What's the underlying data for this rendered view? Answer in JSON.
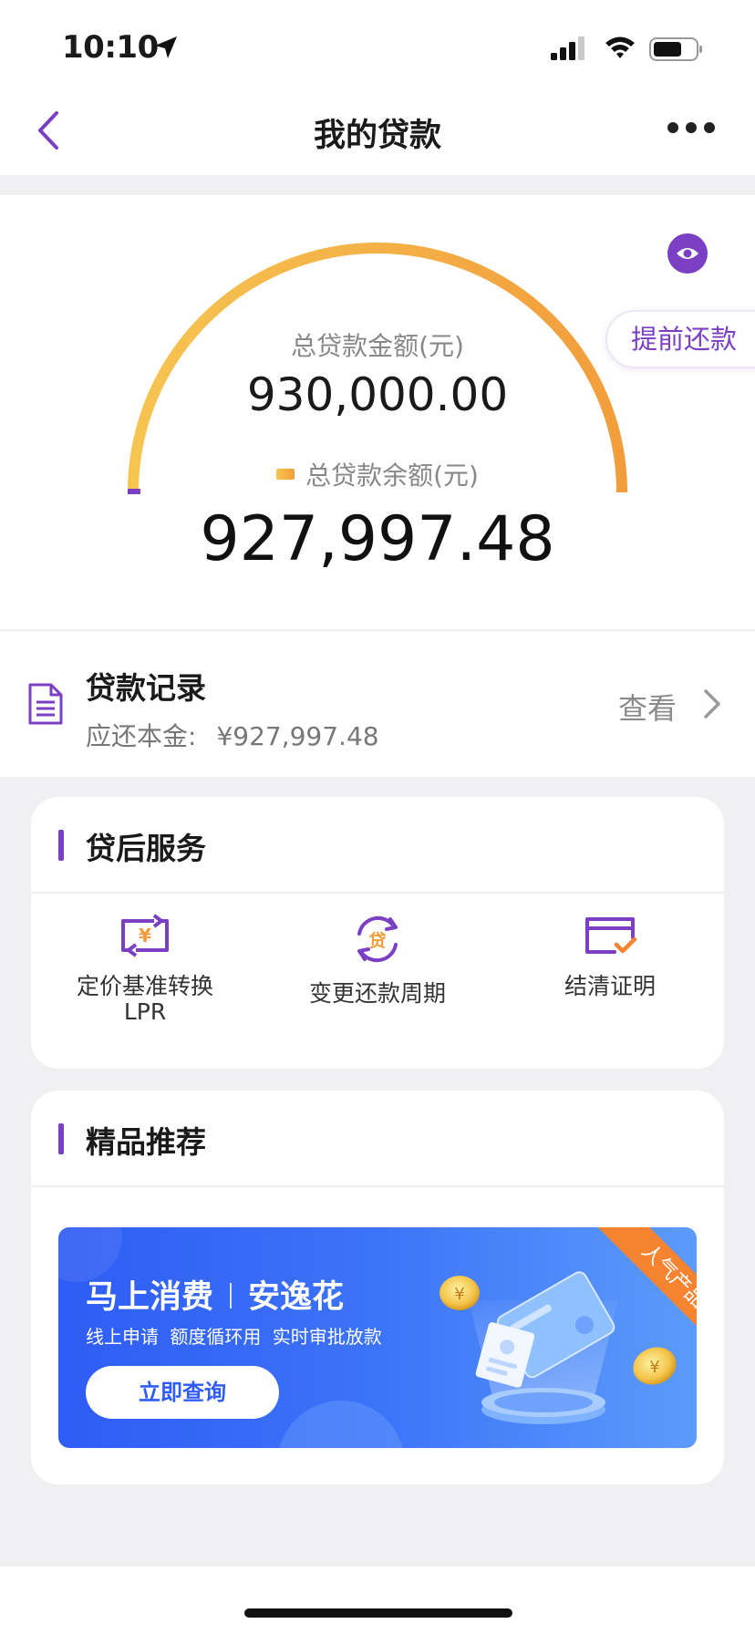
{
  "status_bar": {
    "time": "10:10"
  },
  "nav": {
    "title": "我的贷款",
    "back_icon": "chevron-left-icon",
    "more_icon": "more-dots-icon"
  },
  "summary": {
    "total_label": "总贷款金额(元)",
    "total_value": "930,000.00",
    "remaining_label": "总贷款余额(元)",
    "remaining_value": "927,997.48",
    "prepay_label": "提前还款",
    "eye_icon": "eye-icon",
    "gauge_colors": [
      "#f6c451",
      "#f29d3b"
    ]
  },
  "record": {
    "title": "贷款记录",
    "sub_label": "应还本金:",
    "sub_amount": "¥927,997.48",
    "view_label": "查看"
  },
  "service": {
    "title": "贷后服务",
    "items": [
      {
        "label": "定价基准转换\nLPR",
        "line1": "定价基准转换",
        "line2": "LPR",
        "icon": "exchange-yuan-icon"
      },
      {
        "label": "变更还款周期",
        "icon": "loan-cycle-icon"
      },
      {
        "label": "结清证明",
        "icon": "settlement-card-icon"
      }
    ]
  },
  "recommend": {
    "title": "精品推荐",
    "banner": {
      "brand": "马上消费",
      "product": "安逸花",
      "subtitle": "线上申请 额度循环用 实时审批放款",
      "button": "立即查询",
      "ribbon": "人气产品"
    }
  },
  "colors": {
    "accent": "#7b3fc4",
    "banner_blue": "#2f5cf5",
    "orange": "#f29d3b"
  }
}
